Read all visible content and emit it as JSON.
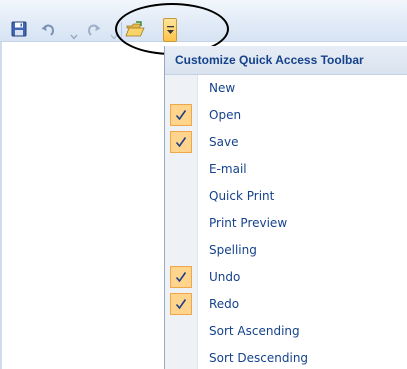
{
  "toolbar": {
    "icons": {
      "save": "save-icon",
      "undo": "undo-icon",
      "undo_dropdown": "chevron-down-icon",
      "redo": "redo-icon",
      "redo_dropdown": "chevron-down-icon",
      "open": "open-folder-icon",
      "customize": "chevron-down-icon"
    },
    "colors": {
      "menu_button": "#ffc24a",
      "text": "#15428b"
    }
  },
  "menu": {
    "title": "Customize Quick Access Toolbar",
    "items": [
      {
        "label": "New",
        "checked": false
      },
      {
        "label": "Open",
        "checked": true
      },
      {
        "label": "Save",
        "checked": true
      },
      {
        "label": "E-mail",
        "checked": false
      },
      {
        "label": "Quick Print",
        "checked": false
      },
      {
        "label": "Print Preview",
        "checked": false
      },
      {
        "label": "Spelling",
        "checked": false
      },
      {
        "label": "Undo",
        "checked": true
      },
      {
        "label": "Redo",
        "checked": true
      },
      {
        "label": "Sort Ascending",
        "checked": false
      },
      {
        "label": "Sort Descending",
        "checked": false
      }
    ]
  }
}
